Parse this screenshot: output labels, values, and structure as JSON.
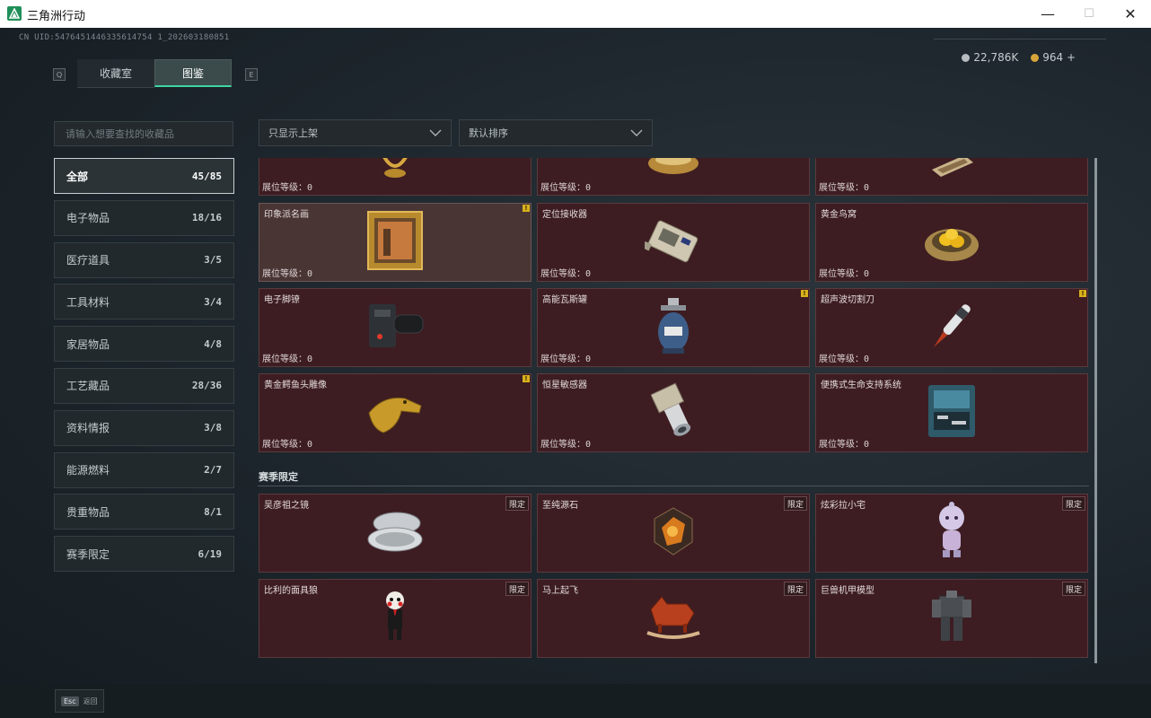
{
  "window": {
    "title": "三角洲行动",
    "minimize": "—",
    "maximize": "☐",
    "close": "✕"
  },
  "header": {
    "uid": "CN UID:5476451446335614754 1_202603180851",
    "key_left": "Q",
    "key_right": "E",
    "tabs": [
      {
        "label": "收藏室",
        "active": false
      },
      {
        "label": "图鉴",
        "active": true
      }
    ],
    "currency": [
      {
        "value": "22,786K",
        "color": "#b7bcc0"
      },
      {
        "value": "964 +",
        "color": "#d9a43a"
      }
    ]
  },
  "search": {
    "placeholder": "请输入想要查找的收藏品"
  },
  "filters": {
    "shelf": "只显示上架",
    "sort": "默认排序"
  },
  "categories": [
    {
      "label": "全部",
      "count": "45/85",
      "active": true
    },
    {
      "label": "电子物品",
      "count": "18/16"
    },
    {
      "label": "医疗道具",
      "count": "3/5"
    },
    {
      "label": "工具材料",
      "count": "3/4"
    },
    {
      "label": "家居物品",
      "count": "4/8"
    },
    {
      "label": "工艺藏品",
      "count": "28/36"
    },
    {
      "label": "资料情报",
      "count": "3/8"
    },
    {
      "label": "能源燃料",
      "count": "2/7"
    },
    {
      "label": "贵重物品",
      "count": "8/1"
    },
    {
      "label": "赛季限定",
      "count": "6/19"
    }
  ],
  "level_label": "展位等级：",
  "top_partial": [
    {
      "level": "0",
      "icon": "golden-statue-icon"
    },
    {
      "level": "0",
      "icon": "gold-urn-icon"
    },
    {
      "level": "0",
      "icon": "map-document-icon"
    }
  ],
  "items": [
    {
      "name": "印象派名画",
      "level": "0",
      "badge": "!",
      "highlight": true,
      "icon": "framed-painting-icon"
    },
    {
      "name": "定位接收器",
      "level": "0",
      "icon": "gps-receiver-icon"
    },
    {
      "name": "黄金鸟窝",
      "level": "0",
      "icon": "golden-nest-icon"
    },
    {
      "name": "电子脚镣",
      "level": "0",
      "icon": "ankle-monitor-icon"
    },
    {
      "name": "高能瓦斯罐",
      "level": "0",
      "badge": "!",
      "icon": "gas-canister-icon"
    },
    {
      "name": "超声波切割刀",
      "level": "0",
      "badge": "!",
      "icon": "ultrasonic-cutter-icon"
    },
    {
      "name": "黄金鳄鱼头雕像",
      "level": "0",
      "badge": "!",
      "icon": "golden-crocodile-icon"
    },
    {
      "name": "恒星敏感器",
      "level": "0",
      "icon": "star-sensor-icon"
    },
    {
      "name": "便携式生命支持系统",
      "level": "0",
      "icon": "life-support-icon"
    }
  ],
  "season_section": {
    "title": "赛季限定",
    "tag": "限定",
    "items": [
      {
        "name": "吴彦祖之镜",
        "icon": "compact-mirror-icon"
      },
      {
        "name": "至纯源石",
        "icon": "source-stone-icon"
      },
      {
        "name": "炫彩拉小宅",
        "icon": "figurine-icon"
      },
      {
        "name": "比利的面具狼",
        "icon": "puppet-icon"
      },
      {
        "name": "马上起飞",
        "icon": "rocking-horse-icon"
      },
      {
        "name": "巨兽机甲模型",
        "icon": "mech-model-icon"
      }
    ]
  },
  "footer": {
    "key": "Esc",
    "label": "返回"
  }
}
